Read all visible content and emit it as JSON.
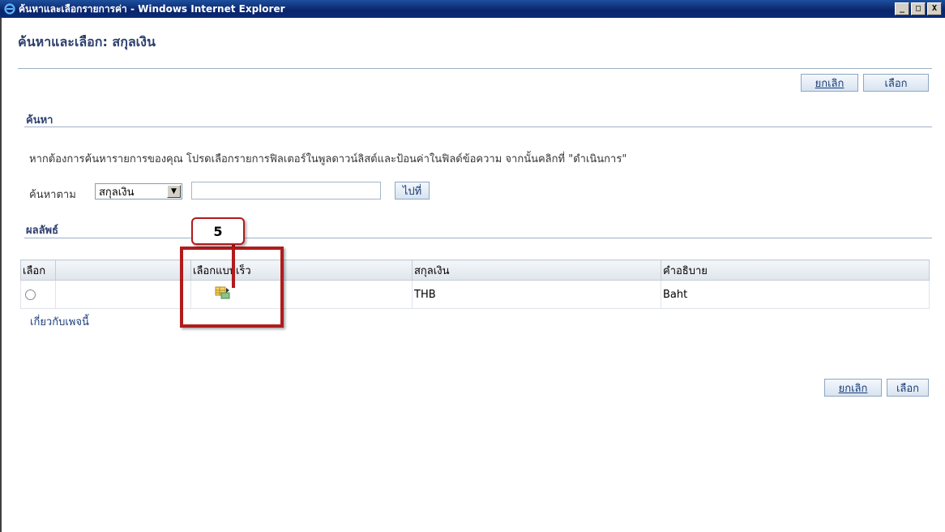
{
  "window": {
    "title": "ค้นหาและเลือกรายการค่า - Windows Internet Explorer",
    "controls": [
      "_",
      "□",
      "X"
    ]
  },
  "page": {
    "title": "ค้นหาและเลือก: สกุลเงิน",
    "cancel_label": "ยกเลิก",
    "select_label": "เลือก"
  },
  "search": {
    "heading": "ค้นหา",
    "help_text": "หากต้องการค้นหารายการของคุณ โปรดเลือกรายการฟิลเตอร์ในพูลดาวน์ลิสต์และป้อนค่าในฟิลด์ข้อความ จากนั้นคลิกที่ \"ดำเนินการ\"",
    "search_by_label": "ค้นหาตาม",
    "search_by_value": "สกุลเงิน",
    "input_value": "",
    "go_label": "ไปที่"
  },
  "results": {
    "heading": "ผลลัพธ์",
    "columns": [
      "เลือก",
      "",
      "เลือกแบบเร็ว",
      "สกุลเงิน",
      "คำอธิบาย"
    ],
    "rows": [
      {
        "currency": "THB",
        "description": "Baht",
        "quick_select_icon": "quick-select-icon"
      }
    ],
    "about_link": "เกี่ยวกับเพจนี้"
  },
  "annotation": {
    "number": "5",
    "color": "#b01c1c"
  }
}
